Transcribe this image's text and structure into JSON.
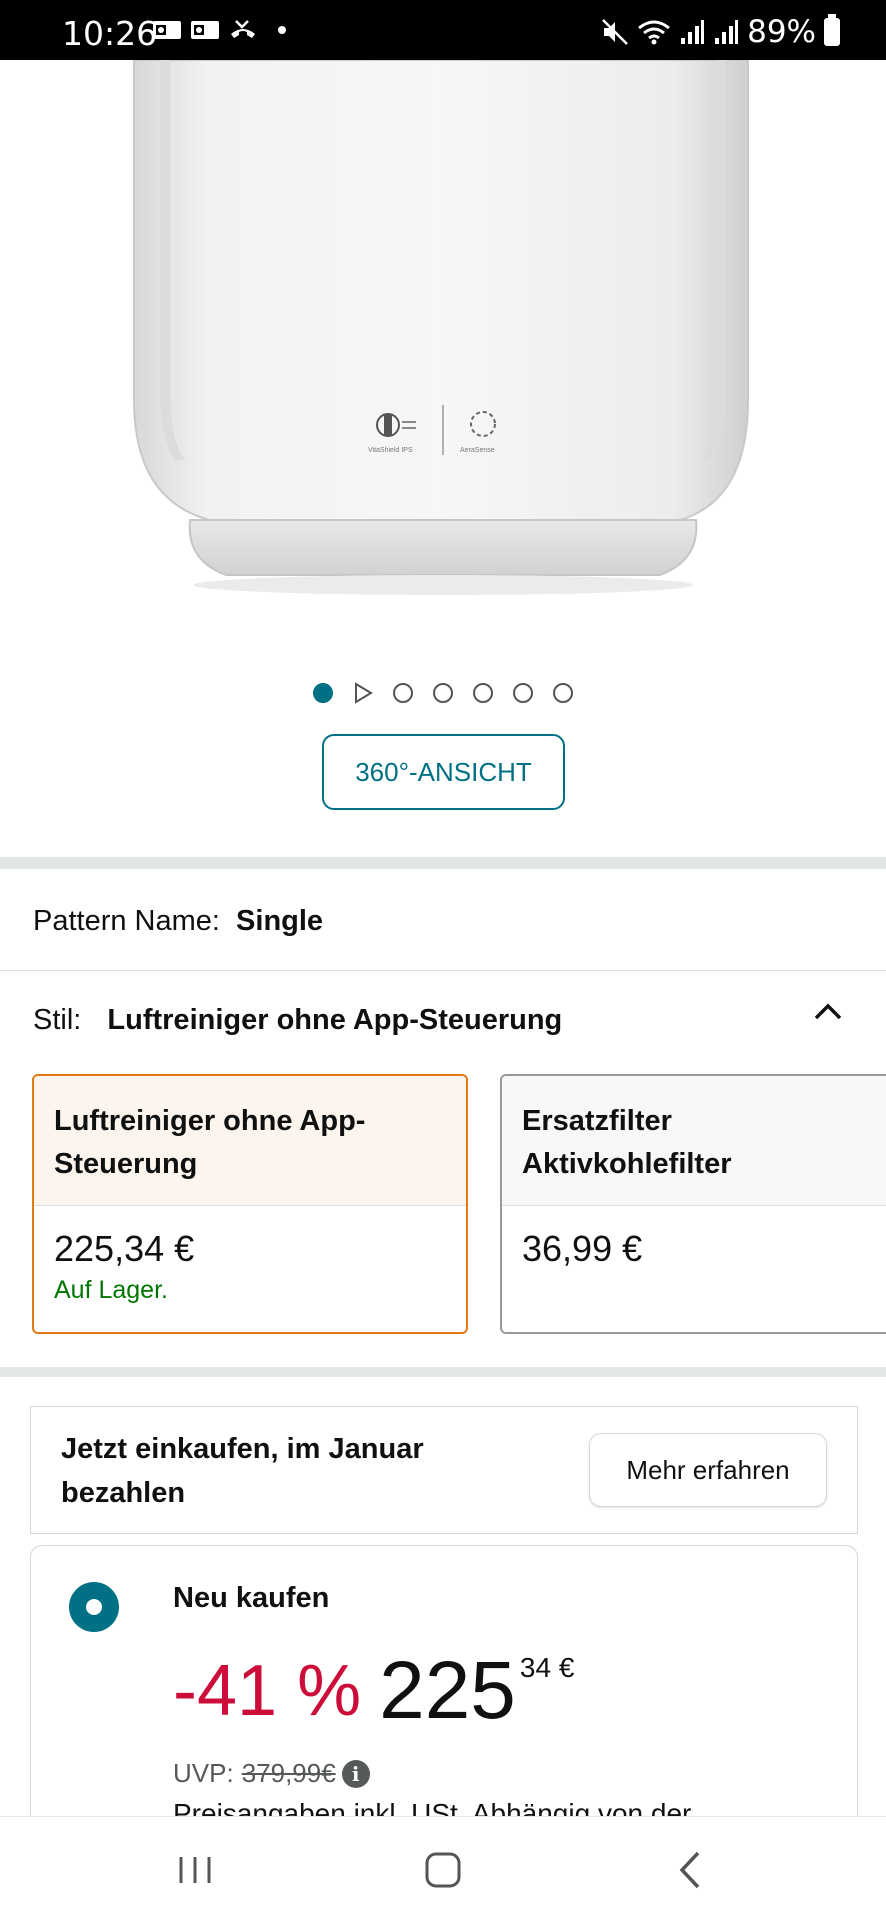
{
  "status_bar": {
    "time": "10:26",
    "battery": "89%"
  },
  "gallery": {
    "total_dots": 7,
    "active_index": 0,
    "btn_360": "360°-ANSICHT"
  },
  "pattern": {
    "label": "Pattern Name:",
    "value": "Single"
  },
  "style": {
    "label": "Stil:",
    "value": "Luftreiniger ohne App-Steuerung"
  },
  "options": [
    {
      "title": "Luftreiniger ohne App-Steuerung",
      "price": "225,34 €",
      "stock": "Auf Lager."
    },
    {
      "title": "Ersatzfilter Aktivkohlefilter",
      "price": "36,99 €",
      "stock": ""
    }
  ],
  "promo": {
    "text": "Jetzt einkaufen, im Januar bezahlen",
    "button": "Mehr erfahren"
  },
  "buy": {
    "option": "Neu kaufen",
    "discount": "-41 %",
    "price_whole": "225",
    "price_cents": "34 €",
    "uvp_label": "UVP:",
    "uvp_value": "379,99€",
    "legal": "Preisangaben inkl. USt. Abhängig von der"
  },
  "colors": {
    "accent": "#007185",
    "discount": "#cc0c39",
    "stock": "#007600",
    "selected_border": "#e47911"
  }
}
